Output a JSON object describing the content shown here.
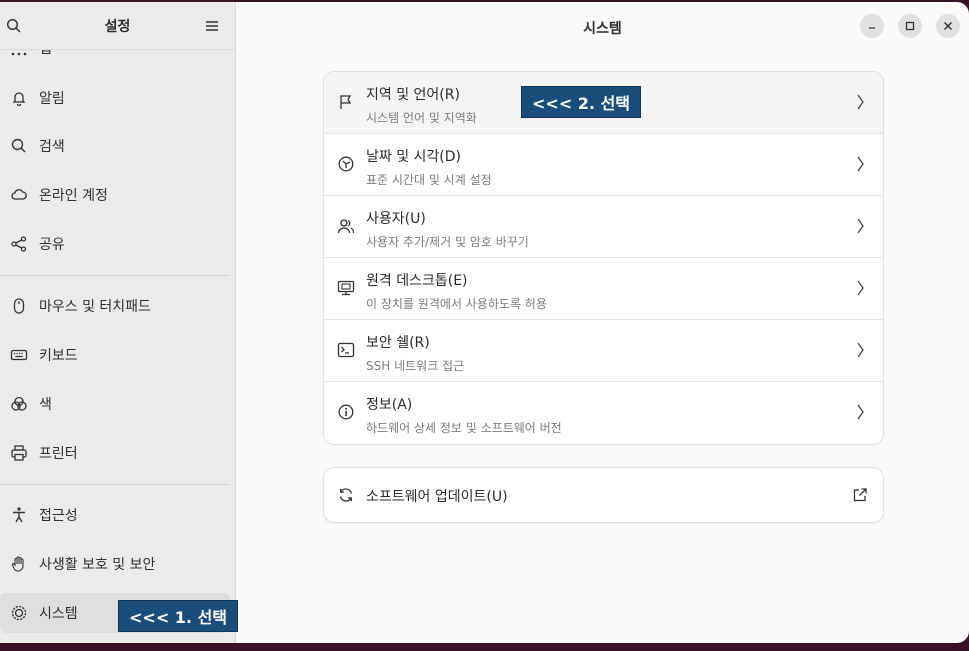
{
  "sidebar": {
    "title": "설정",
    "items": [
      {
        "label": "앱",
        "icon": "apps-icon"
      },
      {
        "label": "알림",
        "icon": "bell-icon"
      },
      {
        "label": "검색",
        "icon": "search-icon"
      },
      {
        "label": "온라인 계정",
        "icon": "cloud-icon"
      },
      {
        "label": "공유",
        "icon": "share-icon"
      },
      {
        "label": "마우스 및 터치패드",
        "icon": "mouse-icon"
      },
      {
        "label": "키보드",
        "icon": "keyboard-icon"
      },
      {
        "label": "색",
        "icon": "color-icon"
      },
      {
        "label": "프린터",
        "icon": "printer-icon"
      },
      {
        "label": "접근성",
        "icon": "accessibility-icon"
      },
      {
        "label": "사생활 보호 및 보안",
        "icon": "hand-icon"
      },
      {
        "label": "시스템",
        "icon": "gear-icon"
      }
    ],
    "callout": "<<< 1. 선택"
  },
  "main": {
    "title": "시스템",
    "rows": [
      {
        "title": "지역 및 언어(R)",
        "subtitle": "시스템 언어 및 지역화",
        "icon": "flag-icon"
      },
      {
        "title": "날짜 및 시각(D)",
        "subtitle": "표준 시간대 및 시계 설정",
        "icon": "clock-icon"
      },
      {
        "title": "사용자(U)",
        "subtitle": "사용자 추가/제거 및 암호 바꾸기",
        "icon": "users-icon"
      },
      {
        "title": "원격 데스크톱(E)",
        "subtitle": "이 장치를 원격에서 사용하도록 허용",
        "icon": "remote-desktop-icon"
      },
      {
        "title": "보안 쉘(R)",
        "subtitle": "SSH 네트워크 접근",
        "icon": "terminal-icon"
      },
      {
        "title": "정보(A)",
        "subtitle": "하드웨어 상세 정보 및 소프트웨어 버전",
        "icon": "info-icon"
      }
    ],
    "callout": "<<< 2. 선택",
    "update": {
      "title": "소프트웨어 업데이트(U)",
      "icon": "refresh-icon"
    }
  }
}
